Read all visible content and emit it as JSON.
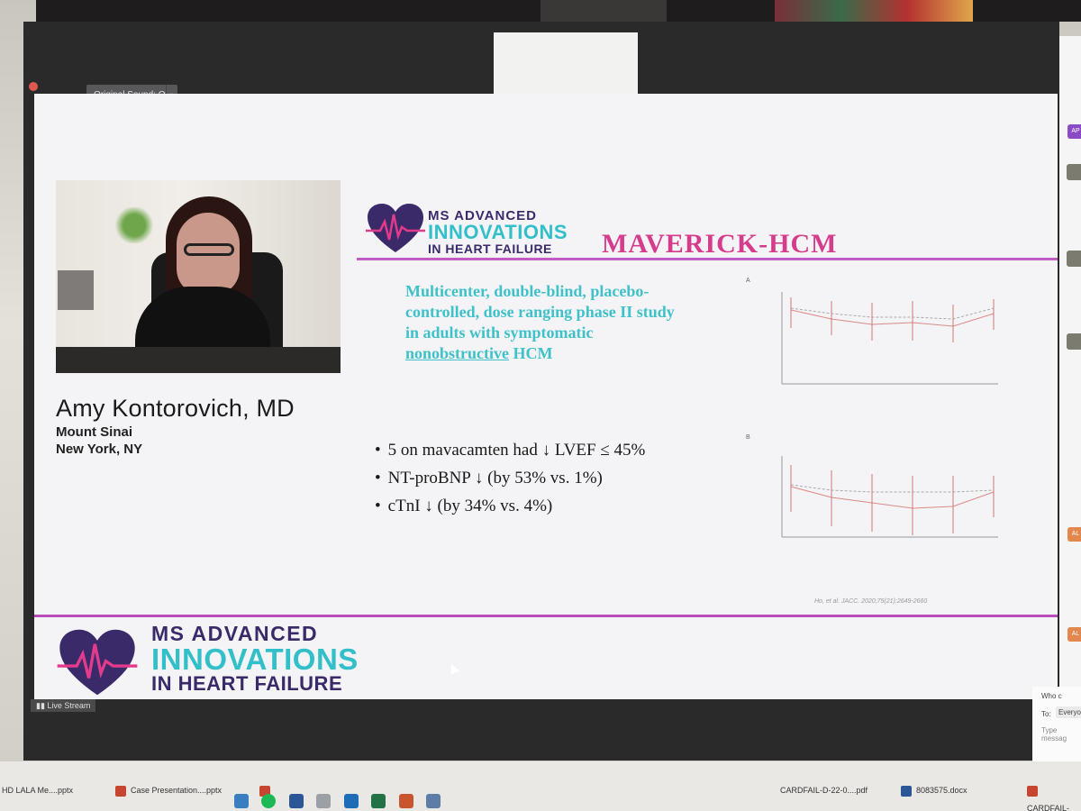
{
  "zoom": {
    "sound_button": "Original Sound: Off",
    "sound_dropdown": "▾",
    "live_stream": "Live Stream"
  },
  "slide": {
    "speaker": {
      "name": "Amy Kontorovich, MD",
      "institution": "Mount Sinai",
      "location": "New York, NY"
    },
    "logo": {
      "line1": "MS ADVANCED",
      "line2": "INNOVATIONS",
      "line3": "IN HEART FAILURE"
    },
    "title": "MAVERICK-HCM",
    "description_main": "Multicenter, double-blind, placebo-controlled, dose ranging phase II study in adults with symptomatic",
    "description_underlined": "nonobstructive",
    "description_end": "HCM",
    "bullets": [
      "5 on mavacamten had ↓ LVEF ≤ 45%",
      "NT-proBNP ↓ (by 53% vs. 1%)",
      "cTnI ↓ (by 34% vs. 4%)"
    ],
    "figure": {
      "panel_a": "A",
      "panel_b": "B",
      "citation": "Ho, et al. JACC. 2020;75(21):2649-2660"
    },
    "colors": {
      "title": "#d63c8c",
      "teal": "#3fc1c9",
      "purple": "#3b2a6a",
      "rule": "#c05cc4"
    }
  },
  "chat": {
    "avatar_initials": [
      "AP",
      "AL",
      "AL"
    ],
    "who": "Who c",
    "to_label": "To:",
    "to_value": "Everyone",
    "type_placeholder": "Type messag"
  },
  "taskbar": {
    "items": [
      "HD LALA Me....pptx",
      "Case Presentation....pptx",
      "CARDFAIL-D-22-0....pdf",
      "8083575.docx",
      "CARDFAIL-"
    ]
  }
}
